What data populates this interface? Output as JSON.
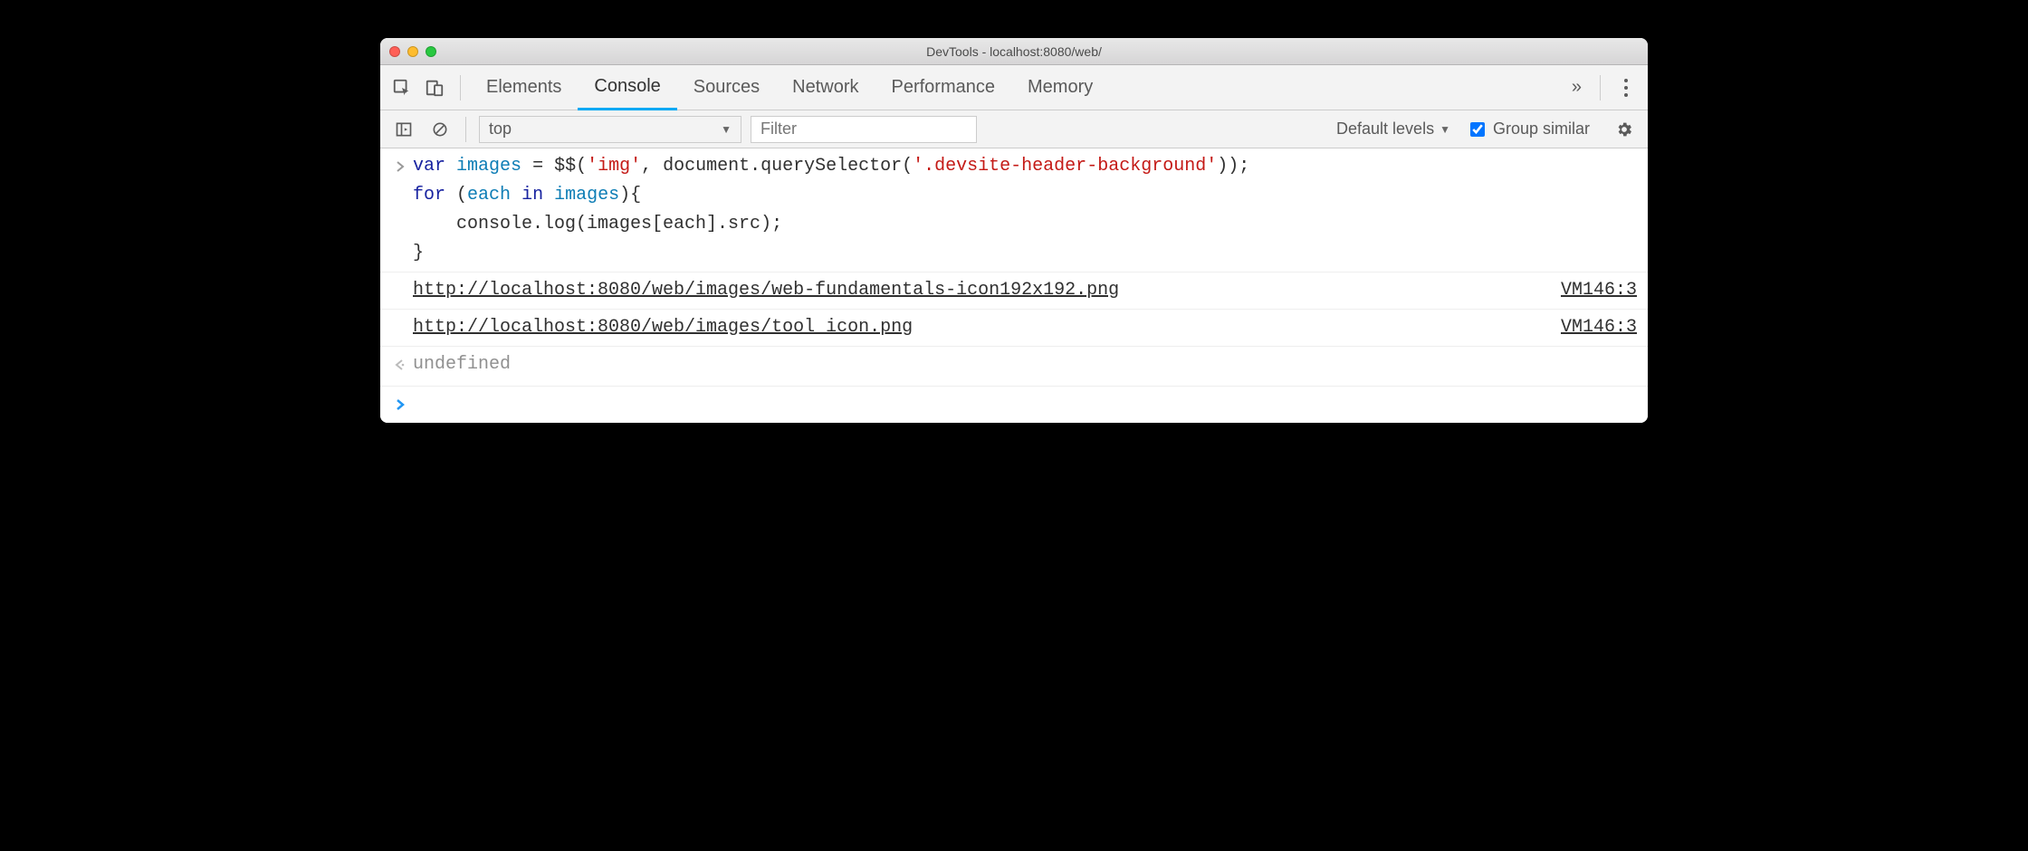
{
  "window": {
    "title": "DevTools - localhost:8080/web/"
  },
  "tabs": {
    "items": [
      "Elements",
      "Console",
      "Sources",
      "Network",
      "Performance",
      "Memory"
    ],
    "active": "Console",
    "overflow": "»"
  },
  "toolbar": {
    "context": "top",
    "filter_placeholder": "Filter",
    "levels_label": "Default levels",
    "group_similar_label": "Group similar",
    "group_similar_checked": true
  },
  "console": {
    "input_prompt": ">",
    "return_marker": "‹",
    "new_prompt": "›",
    "code_tokens": [
      {
        "t": "kw-var",
        "v": "var"
      },
      {
        "t": "sp",
        "v": " "
      },
      {
        "t": "ident",
        "v": "images"
      },
      {
        "t": "sp",
        "v": " "
      },
      {
        "t": "plain",
        "v": "= $$("
      },
      {
        "t": "str",
        "v": "'img'"
      },
      {
        "t": "plain",
        "v": ", document.querySelector("
      },
      {
        "t": "str",
        "v": "'.devsite-header-background'"
      },
      {
        "t": "plain",
        "v": "));"
      },
      {
        "t": "nl",
        "v": "\n"
      },
      {
        "t": "kw-var",
        "v": "for"
      },
      {
        "t": "sp",
        "v": " "
      },
      {
        "t": "plain",
        "v": "("
      },
      {
        "t": "ident",
        "v": "each"
      },
      {
        "t": "sp",
        "v": " "
      },
      {
        "t": "kw-in",
        "v": "in"
      },
      {
        "t": "sp",
        "v": " "
      },
      {
        "t": "ident",
        "v": "images"
      },
      {
        "t": "plain",
        "v": "){"
      },
      {
        "t": "nl",
        "v": "\n"
      },
      {
        "t": "plain",
        "v": "    console.log(images[each].src);"
      },
      {
        "t": "nl",
        "v": "\n"
      },
      {
        "t": "plain",
        "v": "}"
      }
    ],
    "logs": [
      {
        "text": "http://localhost:8080/web/images/web-fundamentals-icon192x192.png",
        "source": "VM146:3"
      },
      {
        "text": "http://localhost:8080/web/images/tool_icon.png",
        "source": "VM146:3"
      }
    ],
    "return_value": "undefined"
  }
}
